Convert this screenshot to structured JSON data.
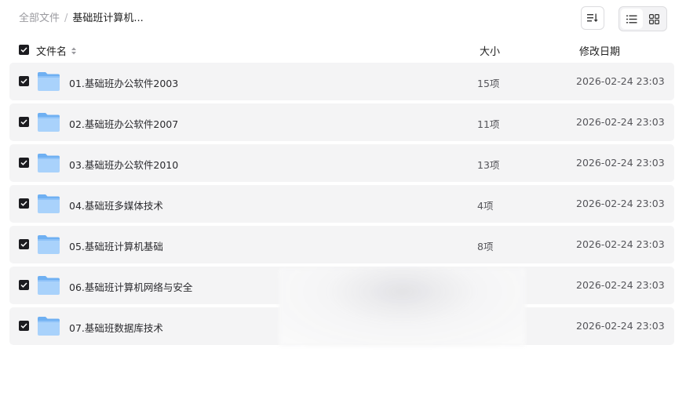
{
  "breadcrumb": {
    "root": "全部文件",
    "separator": "/",
    "current": "基础班计算机..."
  },
  "toolbar": {
    "sort_icon": "sort-icon",
    "list_view_icon": "list-view-icon",
    "grid_view_icon": "grid-view-icon",
    "active_view": "list"
  },
  "table": {
    "headers": {
      "name": "文件名",
      "size": "大小",
      "modified": "修改日期"
    },
    "rows": [
      {
        "name": "01.基础班办公软件2003",
        "size": "15项",
        "modified": "2026-02-24 23:03"
      },
      {
        "name": "02.基础班办公软件2007",
        "size": "11项",
        "modified": "2026-02-24 23:03"
      },
      {
        "name": "03.基础班办公软件2010",
        "size": "13项",
        "modified": "2026-02-24 23:03"
      },
      {
        "name": "04.基础班多媒体技术",
        "size": "4项",
        "modified": "2026-02-24 23:03"
      },
      {
        "name": "05.基础班计算机基础",
        "size": "8项",
        "modified": "2026-02-24 23:03"
      },
      {
        "name": "06.基础班计算机网络与安全",
        "size": "",
        "modified": "2026-02-24 23:03"
      },
      {
        "name": "07.基础班数据库技术",
        "size": "",
        "modified": "2026-02-24 23:03"
      }
    ]
  },
  "colors": {
    "row_bg": "#f4f4f5",
    "checkbox": "#1c1c20",
    "folder_light": "#a9d2fb",
    "folder_dark": "#6fb0f2"
  }
}
